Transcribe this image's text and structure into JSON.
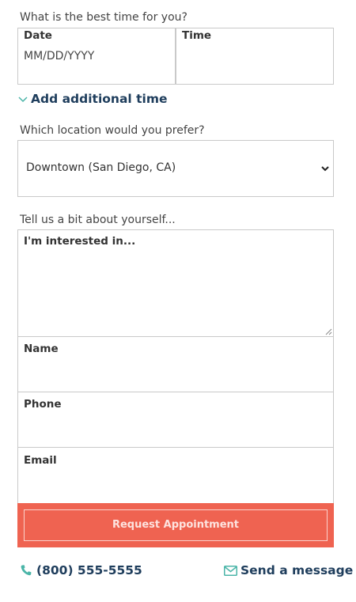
{
  "time_question": "What is the best time for you?",
  "date_field": {
    "label": "Date",
    "placeholder": "MM/DD/YYYY"
  },
  "time_field": {
    "label": "Time"
  },
  "add_time_link": "Add additional time",
  "location_question": "Which location would you prefer?",
  "location_select": {
    "value": "Downtown (San Diego, CA)"
  },
  "about_question": "Tell us a bit about yourself...",
  "interest_field": {
    "label": "I'm interested in..."
  },
  "name_field": {
    "label": "Name"
  },
  "phone_field": {
    "label": "Phone"
  },
  "email_field": {
    "label": "Email"
  },
  "submit_label": "Request Appointment",
  "contact": {
    "phone": "(800) 555-5555",
    "message": "Send a message"
  },
  "colors": {
    "accent": "#ef6351",
    "link": "#1e3d5c",
    "icon": "#4bb5a8",
    "border": "#c9c9c9"
  },
  "icons": [
    "chevron-down-icon",
    "dropdown-arrow-icon",
    "phone-icon",
    "envelope-icon",
    "resize-grip-icon"
  ]
}
